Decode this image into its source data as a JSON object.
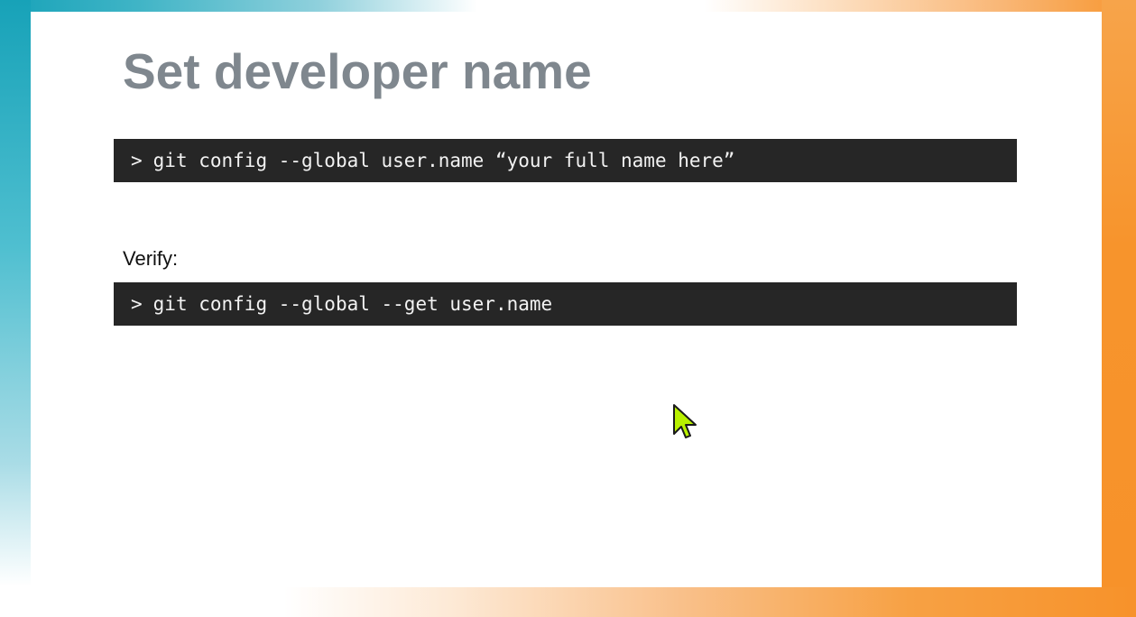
{
  "slide": {
    "title": "Set developer name",
    "verify_label": "Verify:",
    "commands": [
      {
        "prompt": ">",
        "text": "git config --global user.name “your full name here”"
      },
      {
        "prompt": ">",
        "text": "git config --global --get user.name"
      }
    ]
  },
  "colors": {
    "title": "#7f878e",
    "code_background": "#262626",
    "code_text": "#f2f2f2",
    "accent_teal": "#17a2b8",
    "accent_orange": "#f7922a",
    "cursor": "#b8f000"
  },
  "icons": {
    "cursor": "mouse-pointer-icon"
  }
}
